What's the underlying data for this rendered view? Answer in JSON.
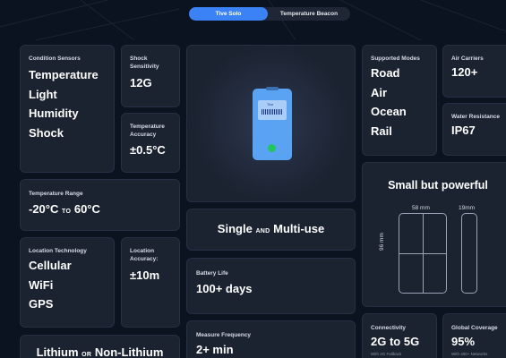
{
  "tabs": {
    "active": "Tive Solo",
    "other": "Temperature Beacon"
  },
  "condition_sensors": {
    "label": "Condition Sensors",
    "items": [
      "Temperature",
      "Light",
      "Humidity",
      "Shock"
    ]
  },
  "shock_sensitivity": {
    "label_line1": "Shock",
    "label_line2": "Sensitivity",
    "value": "12G"
  },
  "temperature_accuracy": {
    "label_line1": "Temperature",
    "label_line2": "Accuracy",
    "value": "±0.5°C"
  },
  "temperature_range": {
    "label": "Temperature Range",
    "low": "-20°C",
    "to": "TO",
    "high": "60°C"
  },
  "location_technology": {
    "label": "Location Technology",
    "items": [
      "Cellular",
      "WiFi",
      "GPS"
    ]
  },
  "location_accuracy": {
    "label_line1": "Location",
    "label_line2": "Accuracy:",
    "value": "±10m"
  },
  "battery_type": {
    "left": "Lithium",
    "or": "OR",
    "right": "Non-Lithium"
  },
  "device": {
    "brand": "Tive",
    "colors": {
      "body": "#5aa2f2",
      "screen": "#a9cdf7",
      "led": "#22c55e"
    }
  },
  "use_mode": {
    "left": "Single",
    "and": "AND",
    "right": "Multi-use"
  },
  "battery_life": {
    "label": "Battery Life",
    "value": "100+ days"
  },
  "measure_frequency": {
    "label": "Measure Frequency",
    "value": "2+ min"
  },
  "supported_modes": {
    "label": "Supported Modes",
    "items": [
      "Road",
      "Air",
      "Ocean",
      "Rail"
    ]
  },
  "air_carriers": {
    "label": "Air Carriers",
    "value": "120+"
  },
  "water_resistance": {
    "label": "Water Resistance",
    "value": "IP67"
  },
  "size": {
    "title": "Small but powerful",
    "width": "58 mm",
    "depth": "19mm",
    "height": "96 mm"
  },
  "connectivity": {
    "label": "Connectivity",
    "value": "2G to 5G",
    "note": "With 2G Fallback"
  },
  "global_coverage": {
    "label": "Global Coverage",
    "value": "95%",
    "note": "With 400+ Networks"
  },
  "colors": {
    "background": "#0b1220",
    "card": "#1b2230",
    "accent": "#3b82f6"
  }
}
